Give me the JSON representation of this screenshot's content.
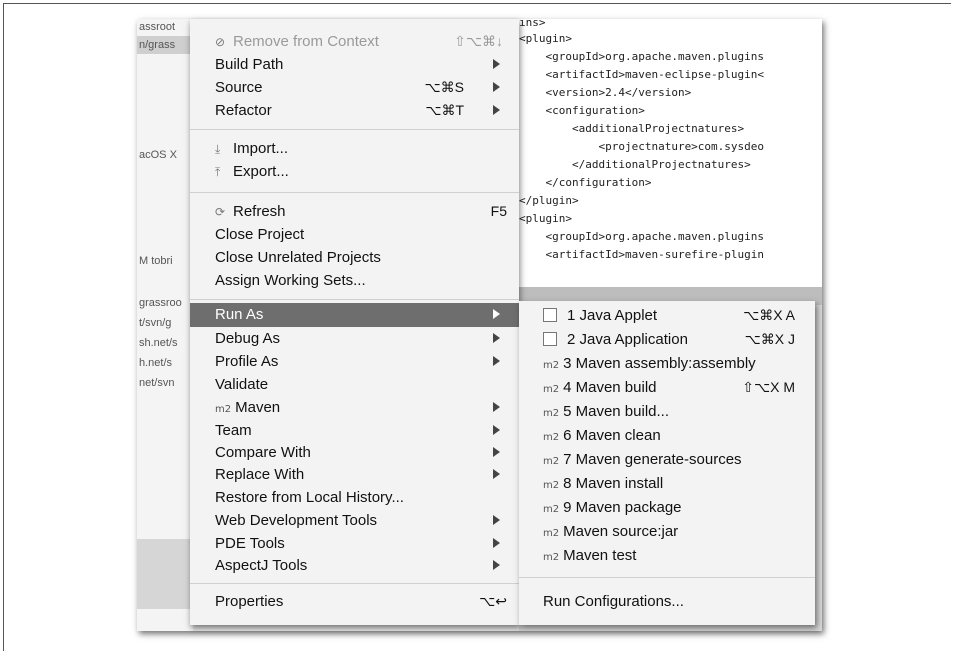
{
  "explorer": {
    "rows": [
      "assroot",
      "n/grass",
      "acOS X",
      "M tobri",
      "grassroo",
      "t/svn/g",
      "sh.net/s",
      "h.net/s",
      "net/svn"
    ]
  },
  "editor": {
    "lines": [
      "ıns>",
      "<plugin>",
      "    <groupId>org.apache.maven.plugins",
      "    <artifactId>maven-eclipse-plugin<",
      "    <version>2.4</version>",
      "    <configuration>",
      "        <additionalProjectnatures>",
      "            <projectnature>com.sysdeo",
      "        </additionalProjectnatures>",
      "    </configuration>",
      "</plugin>",
      "<plugin>",
      "    <groupId>org.apache.maven.plugins",
      "    <artifactId>maven-surefire-plugin"
    ]
  },
  "menu": {
    "remove_from_context": {
      "label": "Remove from Context",
      "shortcut": "⇧⌥⌘↓"
    },
    "build_path": {
      "label": "Build Path"
    },
    "source": {
      "label": "Source",
      "shortcut": "⌥⌘S"
    },
    "refactor": {
      "label": "Refactor",
      "shortcut": "⌥⌘T"
    },
    "import": {
      "label": "Import..."
    },
    "export": {
      "label": "Export..."
    },
    "refresh": {
      "label": "Refresh",
      "shortcut": "F5"
    },
    "close_project": {
      "label": "Close Project"
    },
    "close_unrelated": {
      "label": "Close Unrelated Projects"
    },
    "assign_working_sets": {
      "label": "Assign Working Sets..."
    },
    "run_as": {
      "label": "Run As"
    },
    "debug_as": {
      "label": "Debug As"
    },
    "profile_as": {
      "label": "Profile As"
    },
    "validate": {
      "label": "Validate"
    },
    "maven": {
      "label": "Maven",
      "prefix": "m2"
    },
    "team": {
      "label": "Team"
    },
    "compare_with": {
      "label": "Compare With"
    },
    "replace_with": {
      "label": "Replace With"
    },
    "restore_history": {
      "label": "Restore from Local History..."
    },
    "web_dev_tools": {
      "label": "Web Development Tools"
    },
    "pde_tools": {
      "label": "PDE Tools"
    },
    "aspectj_tools": {
      "label": "AspectJ Tools"
    },
    "properties": {
      "label": "Properties",
      "shortcut": "⌥↩"
    }
  },
  "submenu": {
    "items": [
      {
        "label": "1 Java Applet",
        "shortcut": "⌥⌘X A",
        "icon": "applet-icon"
      },
      {
        "label": "2 Java Application",
        "shortcut": "⌥⌘X J",
        "icon": "java-app-icon"
      },
      {
        "label": "3 Maven assembly:assembly",
        "shortcut": "",
        "prefix": "m2"
      },
      {
        "label": "4 Maven build",
        "shortcut": "⇧⌥X M",
        "prefix": "m2"
      },
      {
        "label": "5 Maven build...",
        "shortcut": "",
        "prefix": "m2"
      },
      {
        "label": "6 Maven clean",
        "shortcut": "",
        "prefix": "m2"
      },
      {
        "label": "7 Maven generate-sources",
        "shortcut": "",
        "prefix": "m2"
      },
      {
        "label": "8 Maven install",
        "shortcut": "",
        "prefix": "m2"
      },
      {
        "label": "9 Maven package",
        "shortcut": "",
        "prefix": "m2"
      },
      {
        "label": "Maven source:jar",
        "shortcut": "",
        "prefix": "m2"
      },
      {
        "label": "Maven test",
        "shortcut": "",
        "prefix": "m2"
      }
    ],
    "run_configurations": "Run Configurations..."
  }
}
